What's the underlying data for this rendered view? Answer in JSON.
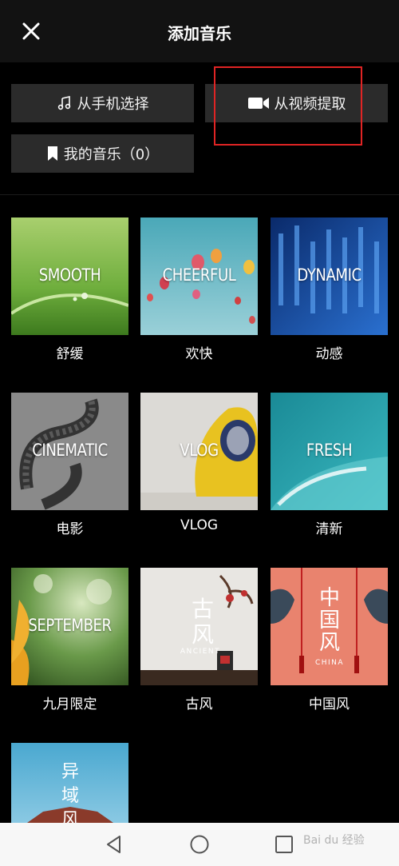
{
  "header": {
    "title": "添加音乐",
    "close_icon": "close-icon"
  },
  "sources": {
    "phone_label": "从手机选择",
    "video_label": "从视频提取",
    "mine_label": "我的音乐（0）"
  },
  "categories": [
    {
      "tag": "SMOOTH",
      "label": "舒缓"
    },
    {
      "tag": "CHEERFUL",
      "label": "欢快"
    },
    {
      "tag": "DYNAMIC",
      "label": "动感"
    },
    {
      "tag": "CINEMATIC",
      "label": "电影"
    },
    {
      "tag": "VLOG",
      "label": "VLOG"
    },
    {
      "tag": "FRESH",
      "label": "清新"
    },
    {
      "tag": "SEPTEMBER",
      "label": "九月限定"
    },
    {
      "tag": "古风",
      "sub": "ANCIENT",
      "label": "古风"
    },
    {
      "tag": "中国风",
      "sub": "CHINA",
      "label": "中国风"
    },
    {
      "tag": "异域风",
      "label": ""
    }
  ],
  "colors": {
    "highlight": "#e02424",
    "button_bg": "#2b2b2b",
    "header_bg": "#121212"
  },
  "watermark": "Bai du 经验"
}
